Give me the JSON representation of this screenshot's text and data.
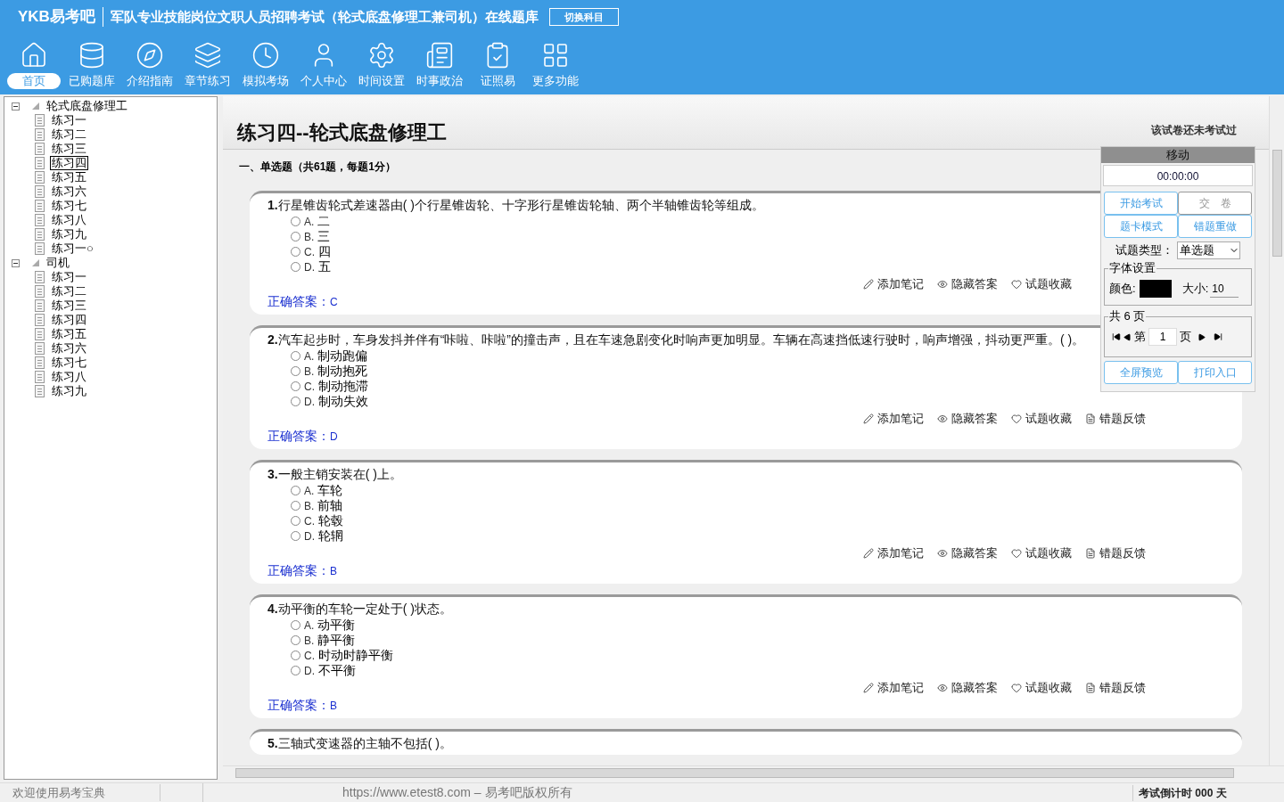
{
  "header": {
    "logo": "YKB易考吧",
    "title": "军队专业技能岗位文职人员招聘考试（轮式底盘修理工兼司机）在线题库",
    "switch_button": "切换科目"
  },
  "nav": [
    {
      "label": "首页",
      "selected": true
    },
    {
      "label": "已购题库",
      "selected": false
    },
    {
      "label": "介绍指南",
      "selected": false
    },
    {
      "label": "章节练习",
      "selected": false
    },
    {
      "label": "模拟考场",
      "selected": false
    },
    {
      "label": "个人中心",
      "selected": false
    },
    {
      "label": "时间设置",
      "selected": false
    },
    {
      "label": "时事政治",
      "selected": false
    },
    {
      "label": "证照易",
      "selected": false
    },
    {
      "label": "更多功能",
      "selected": false
    }
  ],
  "tree": [
    {
      "label": "轮式底盘修理工",
      "expanded": true,
      "children": [
        {
          "label": "练习一",
          "selected": false
        },
        {
          "label": "练习二",
          "selected": false
        },
        {
          "label": "练习三",
          "selected": false
        },
        {
          "label": "练习四",
          "selected": true
        },
        {
          "label": "练习五",
          "selected": false
        },
        {
          "label": "练习六",
          "selected": false
        },
        {
          "label": "练习七",
          "selected": false
        },
        {
          "label": "练习八",
          "selected": false
        },
        {
          "label": "练习九",
          "selected": false
        },
        {
          "label": "练习一○",
          "selected": false
        }
      ]
    },
    {
      "label": "司机",
      "expanded": true,
      "children": [
        {
          "label": "练习一",
          "selected": false
        },
        {
          "label": "练习二",
          "selected": false
        },
        {
          "label": "练习三",
          "selected": false
        },
        {
          "label": "练习四",
          "selected": false
        },
        {
          "label": "练习五",
          "selected": false
        },
        {
          "label": "练习六",
          "selected": false
        },
        {
          "label": "练习七",
          "selected": false
        },
        {
          "label": "练习八",
          "selected": false
        },
        {
          "label": "练习九",
          "selected": false
        }
      ]
    }
  ],
  "paper": {
    "title": "练习四--轮式底盘修理工",
    "status": "该试卷还未考试过",
    "section": "一、单选题（共61题，每题1分）"
  },
  "questions": [
    {
      "number": "1.",
      "text": "行星锥齿轮式差速器由( )个行星锥齿轮、十字形行星锥齿轮轴、两个半轴锥齿轮等组成。",
      "options": [
        {
          "label": "A.",
          "text": "二",
          "selected": false
        },
        {
          "label": "B.",
          "text": "三",
          "selected": false
        },
        {
          "label": "C.",
          "text": "四",
          "selected": false
        },
        {
          "label": "D.",
          "text": "五",
          "selected": false
        }
      ],
      "actions": [
        "添加笔记",
        "隐藏答案",
        "试题收藏"
      ],
      "answer_label": "正确答案：",
      "answer": "C"
    },
    {
      "number": "2.",
      "text": "汽车起步时，车身发抖并伴有“咔啦、咔啦”的撞击声，且在车速急剧变化时响声更加明显。车辆在高速挡低速行驶时，响声增强，抖动更严重。( )。",
      "options": [
        {
          "label": "A.",
          "text": "制动跑偏",
          "selected": false
        },
        {
          "label": "B.",
          "text": "制动抱死",
          "selected": false
        },
        {
          "label": "C.",
          "text": "制动拖滞",
          "selected": false
        },
        {
          "label": "D.",
          "text": "制动失效",
          "selected": false
        }
      ],
      "actions": [
        "添加笔记",
        "隐藏答案",
        "试题收藏",
        "错题反馈"
      ],
      "answer_label": "正确答案：",
      "answer": "D"
    },
    {
      "number": "3.",
      "text": "一般主销安装在( )上。",
      "options": [
        {
          "label": "A.",
          "text": "车轮",
          "selected": false
        },
        {
          "label": "B.",
          "text": "前轴",
          "selected": false
        },
        {
          "label": "C.",
          "text": "轮毂",
          "selected": false
        },
        {
          "label": "D.",
          "text": "轮辋",
          "selected": false
        }
      ],
      "actions": [
        "添加笔记",
        "隐藏答案",
        "试题收藏",
        "错题反馈"
      ],
      "answer_label": "正确答案：",
      "answer": "B"
    },
    {
      "number": "4.",
      "text": "动平衡的车轮一定处于( )状态。",
      "options": [
        {
          "label": "A.",
          "text": "动平衡",
          "selected": false
        },
        {
          "label": "B.",
          "text": "静平衡",
          "selected": false
        },
        {
          "label": "C.",
          "text": "时动时静平衡",
          "selected": false
        },
        {
          "label": "D.",
          "text": "不平衡",
          "selected": false
        }
      ],
      "actions": [
        "添加笔记",
        "隐藏答案",
        "试题收藏",
        "错题反馈"
      ],
      "answer_label": "正确答案：",
      "answer": "B"
    },
    {
      "number": "5.",
      "text": "三轴式变速器的主轴不包括( )。"
    }
  ],
  "panel": {
    "title": "移动",
    "timer": "00:00:00",
    "buttons": [
      {
        "label": "开始考试",
        "disabled": false
      },
      {
        "label": "交　卷",
        "disabled": true
      },
      {
        "label": "题卡模式",
        "disabled": false
      },
      {
        "label": "错题重做",
        "disabled": false
      }
    ],
    "type_label": "试题类型：",
    "type_value": "单选题",
    "font_group": "字体设置",
    "color_label": "颜色:",
    "color": "#000000",
    "size_label": "大小:",
    "size_value": "10",
    "pages_group": "共 6 页",
    "page_prefix": "第",
    "page_value": "1",
    "page_suffix": "页",
    "bottom_buttons": [
      "全屏预览",
      "打印入口"
    ]
  },
  "status_bar": {
    "welcome": "欢迎使用易考宝典",
    "copyright": "https://www.etest8.com – 易考吧版权所有",
    "countdown": "考试倒计时 000 天"
  }
}
